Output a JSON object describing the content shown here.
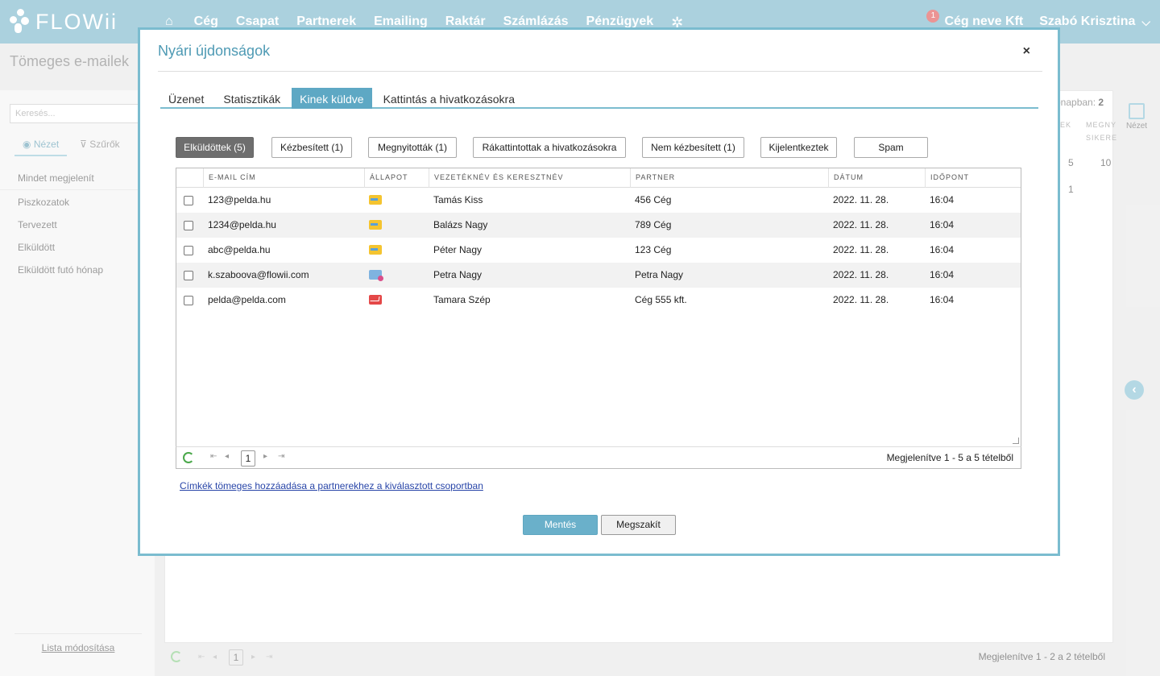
{
  "app": {
    "logo_text": "FLOWii",
    "nav": [
      "Cég",
      "Csapat",
      "Partnerek",
      "Emailing",
      "Raktár",
      "Számlázás",
      "Pénzügyek"
    ],
    "notification_count": "1",
    "company": "Cég neve Kft",
    "user": "Szabó Krisztina"
  },
  "background": {
    "page_title": "Tömeges e-mailek",
    "search_placeholder": "Keresés...",
    "side_tabs": [
      "Nézet",
      "Szűrők"
    ],
    "side_items": [
      "Mindet megjelenít",
      "Piszkozatok",
      "Tervezett",
      "Elküldött",
      "Elküldött futó hónap"
    ],
    "side_footer": "Lista módosítása",
    "header_right_label": "ónapban:",
    "header_right_value": "2",
    "col_a": "EK",
    "col_b": "MEGNY",
    "col_b2": "SIKERE",
    "cell_1a": "5",
    "cell_1b": "10",
    "cell_2a": "1",
    "nezet_label": "Nézet",
    "pager_page": "1",
    "pager_text": "Megjelenítve 1 - 2 a 2 tételből"
  },
  "modal": {
    "title": "Nyári újdonságok",
    "tabs": [
      "Üzenet",
      "Statisztikák",
      "Kinek küldve",
      "Kattintás a hivatkozásokra"
    ],
    "active_tab": 2,
    "filters": [
      "Elküldöttek (5)",
      "Kézbesített (1)",
      "Megnyitották (1)",
      "Rákattintottak a hivatkozásokra",
      "Nem kézbesített (1)",
      "Kijelentkeztek",
      "Spam"
    ],
    "columns": [
      "E-mail cím",
      "Állapot",
      "Vezetéknév és keresztnév",
      "Partner",
      "Dátum",
      "Időpont"
    ],
    "rows": [
      {
        "email": "123@pelda.hu",
        "status": "sent-icon",
        "name": "Tamás Kiss",
        "partner": "456 Cég",
        "date": "2022. 11. 28.",
        "time": "16:04"
      },
      {
        "email": "1234@pelda.hu",
        "status": "sent-icon",
        "name": "Balázs Nagy",
        "partner": "789 Cég",
        "date": "2022. 11. 28.",
        "time": "16:04"
      },
      {
        "email": "abc@pelda.hu",
        "status": "sent-icon",
        "name": "Péter Nagy",
        "partner": "123 Cég",
        "date": "2022. 11. 28.",
        "time": "16:04"
      },
      {
        "email": "k.szaboova@flowii.com",
        "status": "opened-icon",
        "name": "Petra Nagy",
        "partner": "Petra Nagy",
        "date": "2022. 11. 28.",
        "time": "16:04"
      },
      {
        "email": "pelda@pelda.com",
        "status": "error-icon",
        "name": "Tamara Szép",
        "partner": "Cég 555 kft.",
        "date": "2022. 11. 28.",
        "time": "16:04"
      }
    ],
    "pager_page": "1",
    "pager_info": "Megjelenítve 1 - 5 a 5 tételből",
    "bulk_link": "Címkék tömeges hozzáadása a partnerekhez a kiválasztott csoportban",
    "save_label": "Mentés",
    "cancel_label": "Megszakít",
    "close_symbol": "×"
  }
}
